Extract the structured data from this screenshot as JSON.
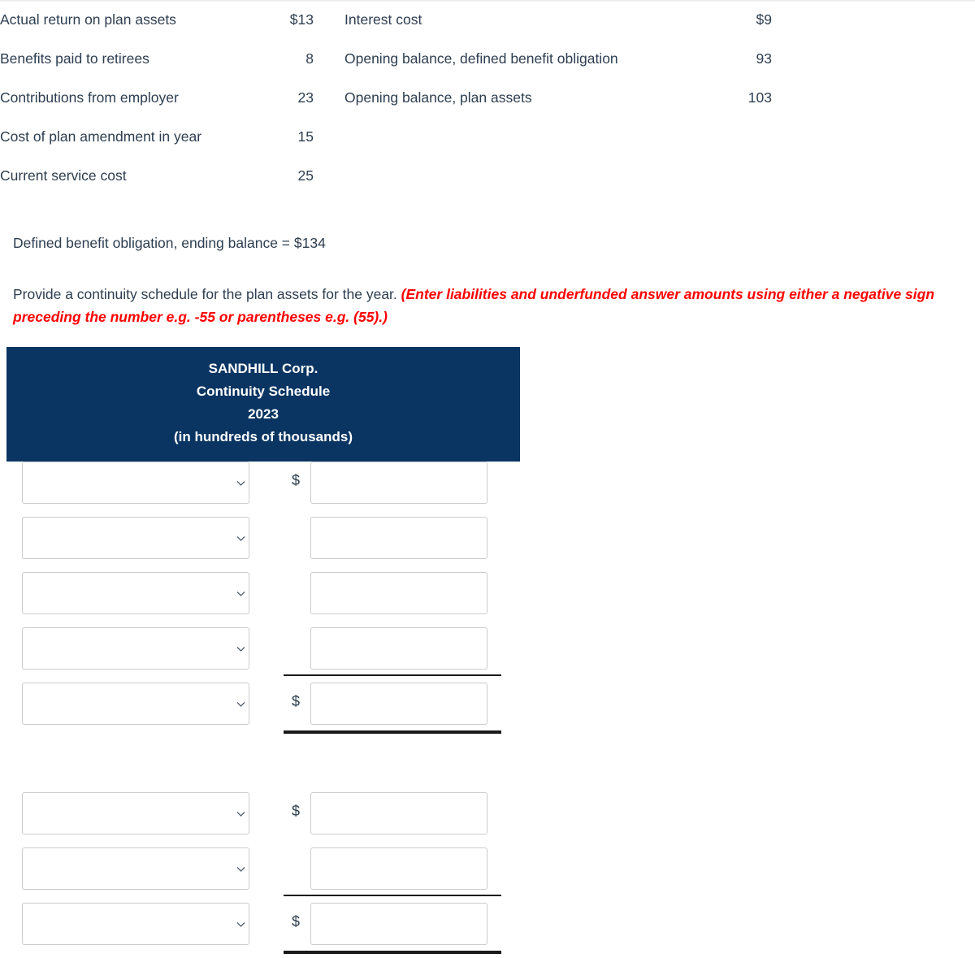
{
  "given_data": {
    "rows": [
      {
        "label_left": "Actual return on plan assets",
        "value_left": "$13",
        "label_right": "Interest cost",
        "value_right": "$9"
      },
      {
        "label_left": "Benefits paid to retirees",
        "value_left": "8",
        "label_right": "Opening balance, defined benefit obligation",
        "value_right": "93"
      },
      {
        "label_left": "Contributions from employer",
        "value_left": "23",
        "label_right": "Opening balance, plan assets",
        "value_right": "103"
      },
      {
        "label_left": "Cost of plan amendment in year",
        "value_left": "15",
        "label_right": "",
        "value_right": ""
      },
      {
        "label_left": "Current service cost",
        "value_left": "25",
        "label_right": "",
        "value_right": ""
      }
    ]
  },
  "ending_balance_line": "Defined benefit obligation, ending balance = $134",
  "prompt": {
    "text": "Provide a continuity schedule for the plan assets for the year.",
    "hint": "(Enter liabilities and underfunded answer amounts using either a negative sign preceding the number e.g. -55 or parentheses e.g. (55).)",
    "hint_color": "#ff0000"
  },
  "schedule": {
    "header_bg": "#0a3563",
    "header_lines": [
      "SANDHILL Corp.",
      "Continuity Schedule",
      "2023",
      "(in hundreds of thousands)"
    ],
    "currency_symbol": "$",
    "select_placeholder": "",
    "amount_placeholder": "",
    "rows": [
      {
        "select_value": "",
        "amount_value": "",
        "dollar": true,
        "rule_above": "none",
        "rule_below": "none"
      },
      {
        "select_value": "",
        "amount_value": "",
        "dollar": false,
        "rule_above": "none",
        "rule_below": "none"
      },
      {
        "select_value": "",
        "amount_value": "",
        "dollar": false,
        "rule_above": "none",
        "rule_below": "none"
      },
      {
        "select_value": "",
        "amount_value": "",
        "dollar": false,
        "rule_above": "none",
        "rule_below": "single"
      },
      {
        "select_value": "",
        "amount_value": "",
        "dollar": true,
        "rule_above": "none",
        "rule_below": "double"
      },
      {
        "select_value": "",
        "amount_value": "",
        "dollar": true,
        "rule_above": "none",
        "rule_below": "none"
      },
      {
        "select_value": "",
        "amount_value": "",
        "dollar": false,
        "rule_above": "none",
        "rule_below": "single"
      },
      {
        "select_value": "",
        "amount_value": "",
        "dollar": true,
        "rule_above": "none",
        "rule_below": "double"
      }
    ]
  }
}
